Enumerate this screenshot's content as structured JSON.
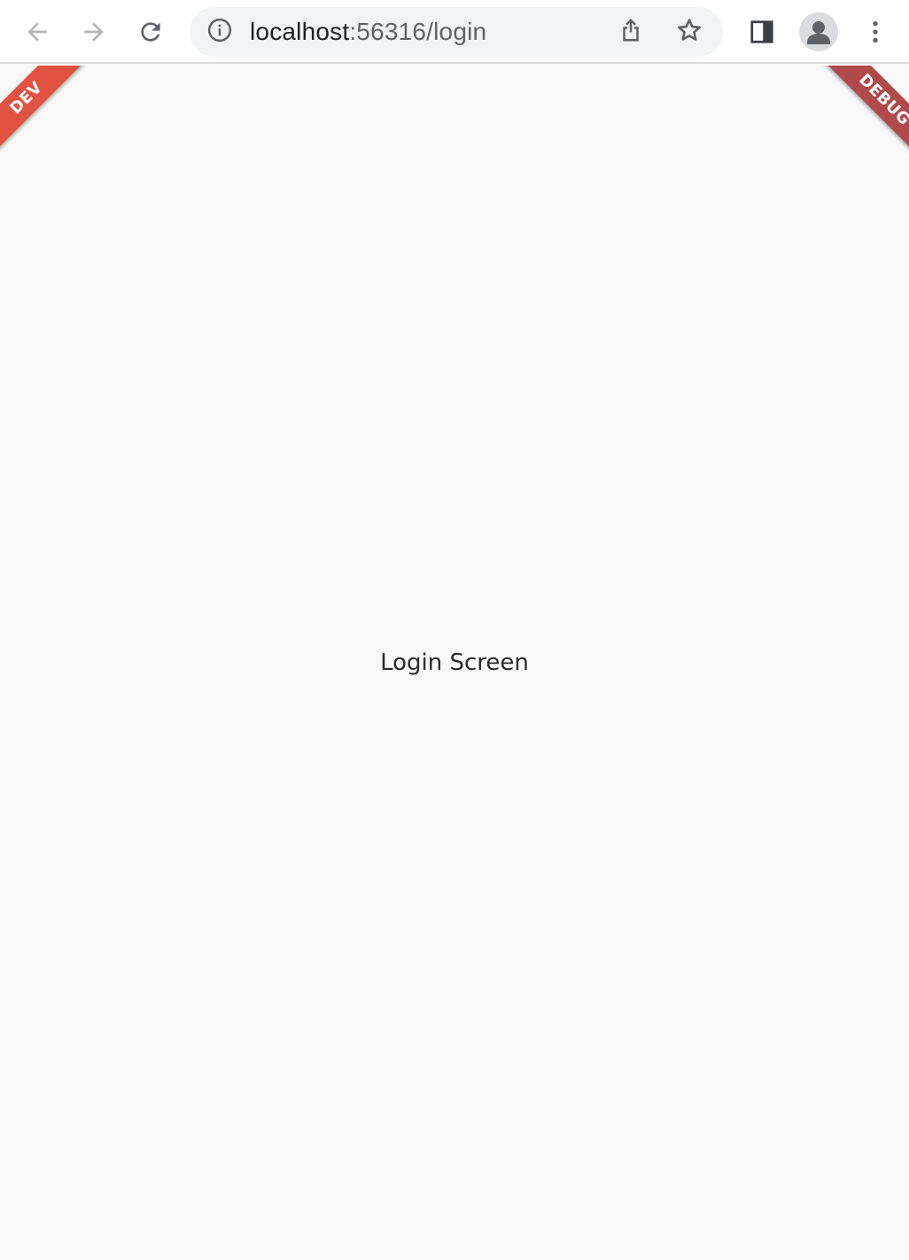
{
  "browser": {
    "url_host": "localhost",
    "url_path": ":56316/login",
    "icons": {
      "back": "arrow-left-icon",
      "forward": "arrow-right-icon",
      "reload": "reload-icon",
      "site_info": "info-icon",
      "share": "share-icon",
      "bookmark": "star-icon",
      "side_panel": "side-panel-icon",
      "profile": "person-icon",
      "menu": "kebab-menu-icon"
    },
    "colors": {
      "toolbar_bg": "#ffffff",
      "omnibox_bg": "#f1f3f4",
      "icon_active": "#5f6368",
      "icon_disabled": "#b4b4b4"
    }
  },
  "page": {
    "body_text": "Login Screen",
    "background": "#f9f9f9"
  },
  "banners": {
    "left_label": "DEV",
    "left_color": "#e15241",
    "right_label": "DEBUG",
    "right_color": "#b04a4a"
  }
}
